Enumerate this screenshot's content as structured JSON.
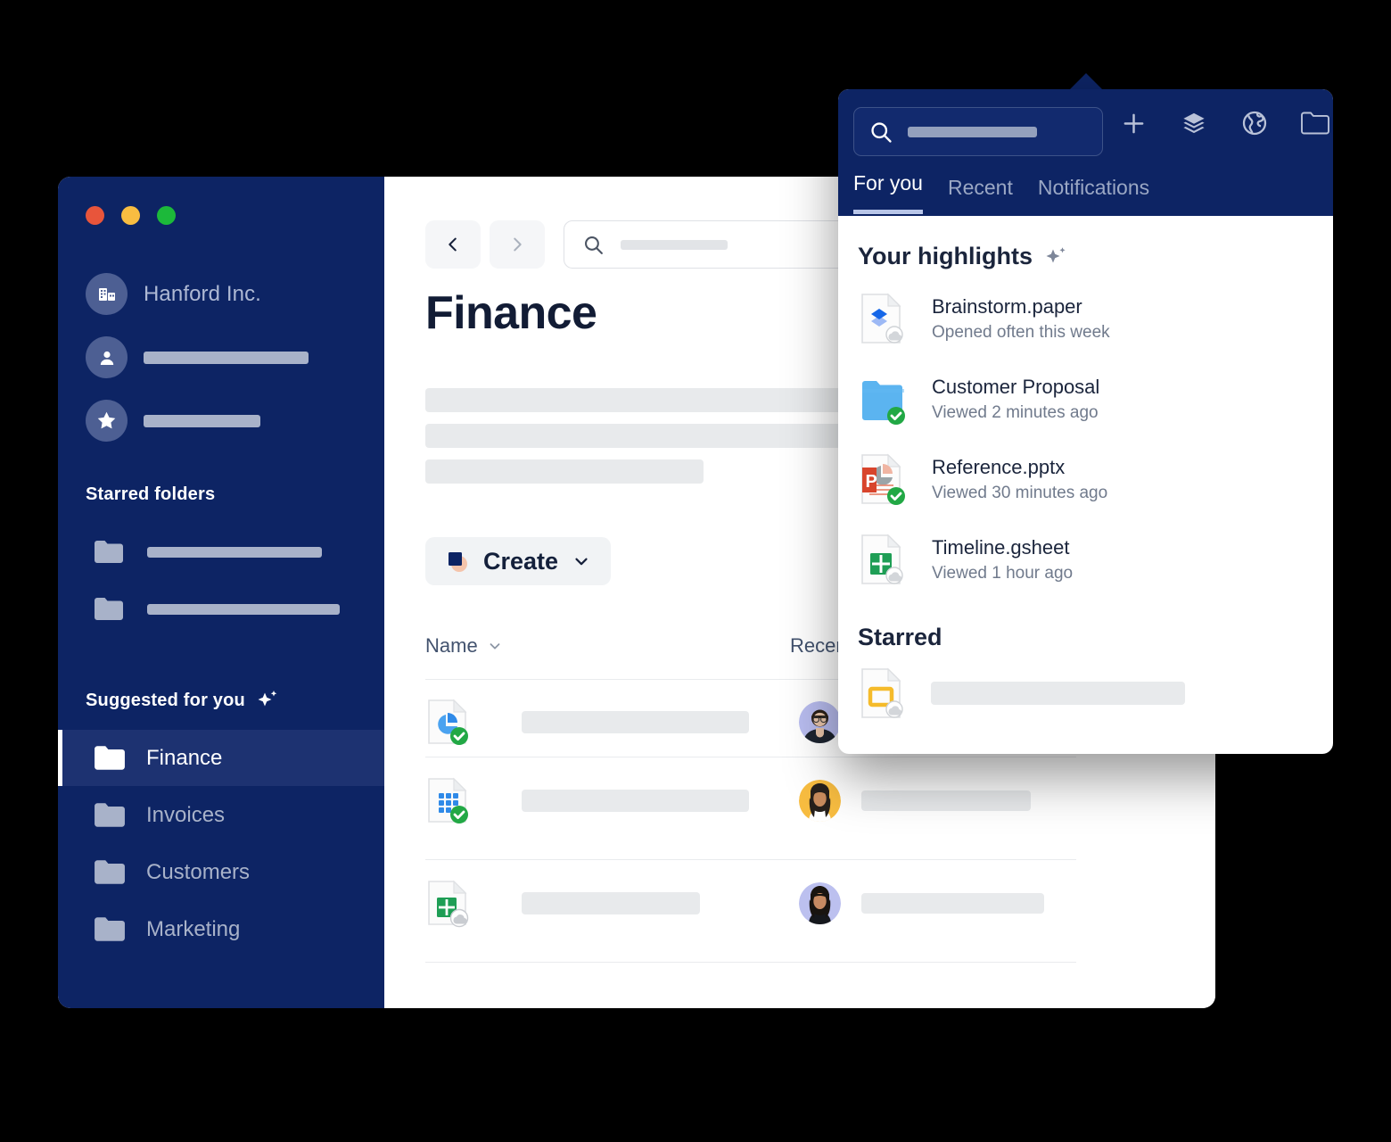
{
  "window": {
    "traffic_lights": [
      "close",
      "minimize",
      "zoom"
    ],
    "account": {
      "org_name": "Hanford Inc.",
      "org_icon": "building-icon",
      "person_icon": "person-icon",
      "star_icon": "star-icon"
    },
    "sidebar": {
      "starred_folders_title": "Starred folders",
      "starred_folders": [
        {
          "icon": "folder-icon",
          "label": ""
        },
        {
          "icon": "folder-icon",
          "label": ""
        }
      ],
      "suggested_title": "Suggested for you",
      "suggested_icon": "sparkle-icon",
      "suggested_items": [
        {
          "label": "Finance",
          "active": true
        },
        {
          "label": "Invoices",
          "active": false
        },
        {
          "label": "Customers",
          "active": false
        },
        {
          "label": "Marketing",
          "active": false
        }
      ]
    },
    "toolbar": {
      "back_icon": "chevron-left-icon",
      "forward_icon": "chevron-right-icon",
      "search_icon": "search-icon",
      "search_value": "",
      "search_placeholder": ""
    },
    "main": {
      "page_title": "Finance",
      "create_label": "Create",
      "create_caret_icon": "chevron-down-icon",
      "columns": [
        {
          "label": "Name",
          "sort_icon": "chevron-down-icon"
        },
        {
          "label": "Recent",
          "sort_icon": ""
        }
      ],
      "rows": [
        {
          "file_icon": "pie-chart-doc-icon",
          "badge": "synced-check",
          "avatar": "avatar-man-glasses"
        },
        {
          "file_icon": "spreadsheet-grid-icon",
          "badge": "synced-check",
          "avatar": "avatar-woman-yellow"
        },
        {
          "file_icon": "gsheet-doc-icon",
          "badge": "cloud-badge",
          "avatar": "avatar-woman-lavender"
        }
      ]
    }
  },
  "popup": {
    "search": {
      "icon": "search-icon",
      "value": "",
      "placeholder": ""
    },
    "header_icons": [
      {
        "name": "plus-icon"
      },
      {
        "name": "layers-icon"
      },
      {
        "name": "globe-icon"
      },
      {
        "name": "folder-icon"
      }
    ],
    "tabs": [
      {
        "label": "For you",
        "active": true
      },
      {
        "label": "Recent",
        "active": false
      },
      {
        "label": "Notifications",
        "active": false
      }
    ],
    "highlights": {
      "title": "Your highlights",
      "title_icon": "sparkle-icon",
      "items": [
        {
          "name": "Brainstorm.paper",
          "sub": "Opened often this week",
          "icon": "paper-doc-icon",
          "badge": "cloud-badge"
        },
        {
          "name": "Customer Proposal",
          "sub": "Viewed 2 minutes ago",
          "icon": "blue-folder-icon",
          "badge": "synced-check"
        },
        {
          "name": "Reference.pptx",
          "sub": "Viewed 30 minutes ago",
          "icon": "powerpoint-doc-icon",
          "badge": "synced-check"
        },
        {
          "name": "Timeline.gsheet",
          "sub": "Viewed 1 hour ago",
          "icon": "gsheet-doc-icon",
          "badge": "cloud-badge"
        }
      ]
    },
    "starred": {
      "title": "Starred",
      "items": [
        {
          "name": "",
          "icon": "slides-doc-icon",
          "badge": "cloud-badge"
        }
      ]
    }
  },
  "colors": {
    "brand_navy": "#0d2464",
    "nav_active": "#1d3271",
    "accent_blue": "#1667e8",
    "success_green": "#22a845",
    "warn_yellow": "#f5bb2b",
    "ppt_red": "#d8442c",
    "folder_blue": "#5bb4f0"
  }
}
